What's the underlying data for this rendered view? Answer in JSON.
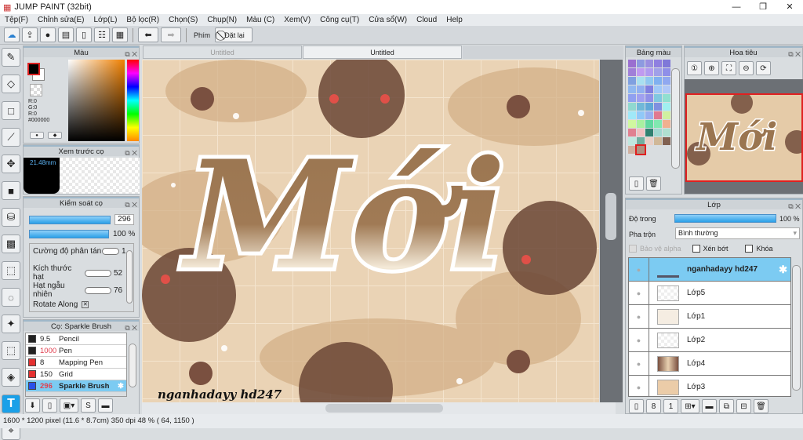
{
  "app": {
    "title": "JUMP PAINT (32bit)"
  },
  "menu": [
    "Tệp(F)",
    "Chỉnh sửa(E)",
    "Lớp(L)",
    "Bộ lọc(R)",
    "Chọn(S)",
    "Chụp(N)",
    "Màu (C)",
    "Xem(V)",
    "Công cụ(T)",
    "Cửa sổ(W)",
    "Cloud",
    "Help"
  ],
  "toolbar": {
    "shortcut_label": "Phím",
    "reset_label": "Đặt lại"
  },
  "tabs": [
    "Untitled",
    "Untitled"
  ],
  "color_panel": {
    "title": "Màu",
    "r": "R:0",
    "g": "G:0",
    "b": "R:0",
    "hex": "#000000"
  },
  "brush_preview": {
    "title": "Xem trước cọ",
    "size": "21.48mm"
  },
  "brush_control": {
    "title": "Kiểm soát cọ",
    "size_value": "296",
    "opacity_value": "100 %",
    "params": [
      {
        "label": "Cường độ phân tán",
        "value": "1"
      },
      {
        "label": "Kích thước hạt",
        "value": "52"
      },
      {
        "label": "Hạt ngẫu nhiên",
        "value": "76"
      }
    ],
    "rotate_label": "Rotate Along"
  },
  "brush_list": {
    "title": "Cọ: Sparkle Brush",
    "items": [
      {
        "size": "9.5",
        "name": "Pencil",
        "color": "#222222"
      },
      {
        "size": "1000",
        "name": "Pen",
        "color": "#222222"
      },
      {
        "size": "8",
        "name": "Mapping Pen",
        "color": "#e53030"
      },
      {
        "size": "150",
        "name": "Grid",
        "color": "#e53030"
      },
      {
        "size": "296",
        "name": "Sparkle Brush",
        "color": "#2a50e8"
      }
    ]
  },
  "palette": {
    "title": "Bảng màu",
    "colors": [
      "#9a6fd0",
      "#8d9ae0",
      "#9a8fe0",
      "#8f7fe0",
      "#7f78d8",
      "#a07fd8",
      "#c09af0",
      "#b09af0",
      "#a0a0e8",
      "#8f8fe8",
      "#7fa0e0",
      "#a8e0f0",
      "#90c8f0",
      "#80b0f0",
      "#90a8f0",
      "#90b8f0",
      "#90b0f0",
      "#8080e0",
      "#a0c8f8",
      "#b0c8f8",
      "#90a0f0",
      "#a0a0f0",
      "#9090e8",
      "#80c8e0",
      "#90e0d0",
      "#90d8d0",
      "#70b8d8",
      "#60a8d8",
      "#8090e0",
      "#a0f0f0",
      "#a0e8f8",
      "#90c8f8",
      "#98b0f0",
      "#e07890",
      "#d0f0a0",
      "#d0f8a0",
      "#a8f0a0",
      "#60d8a0",
      "#80e8b0",
      "#f0b090",
      "#e08090",
      "#f0c0c0",
      "#308070",
      "#a0d8d0",
      "#b0e0d0",
      "#c0e8e0",
      "#70b0a0",
      "#e8d0c8",
      "#d0b898",
      "#806050",
      "#d0b0a0",
      "#b09080"
    ]
  },
  "navigator": {
    "title": "Hoa tiêu"
  },
  "layers": {
    "title": "Lớp",
    "opacity_label": "Độ trong",
    "opacity_value": "100 %",
    "opacity_fraction": 1.0,
    "blend_label": "Pha trộn",
    "blend_value": "Bình thường",
    "protect_alpha": "Bảo vệ alpha",
    "clip": "Xén bớt",
    "lock": "Khóa",
    "items": [
      {
        "name": "nganhadayy hd247",
        "selected": true
      },
      {
        "name": "Lớp5"
      },
      {
        "name": "Lớp1"
      },
      {
        "name": "Lớp2"
      },
      {
        "name": "Lớp4"
      },
      {
        "name": "Lớp3"
      }
    ]
  },
  "canvas": {
    "title_text": "Mới",
    "signature": "nganhadayy hd247"
  },
  "status": "1600 * 1200 pixel   (11.6 * 8.7cm)   350 dpi   48 %   ( 64, 1150 )"
}
